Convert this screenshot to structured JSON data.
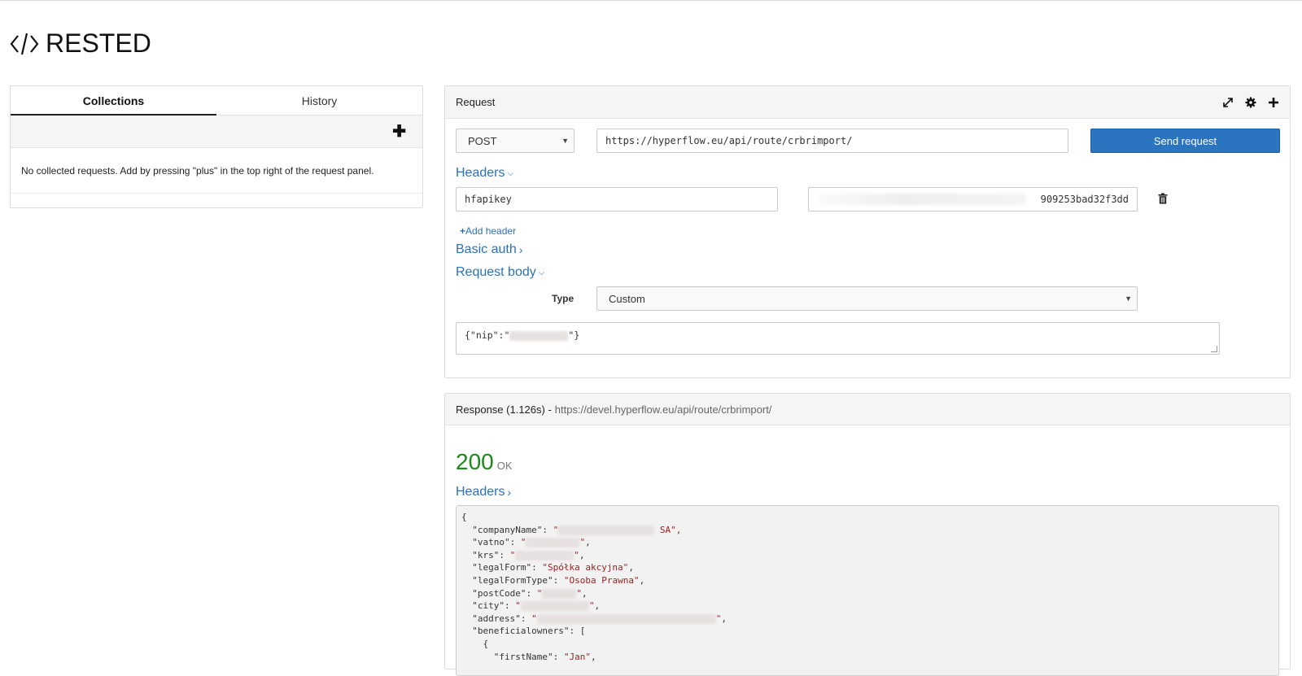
{
  "brand": {
    "title": "RESTED"
  },
  "left": {
    "tabs": [
      {
        "label": "Collections",
        "active": true
      },
      {
        "label": "History",
        "active": false
      }
    ],
    "empty_message": "No collected requests. Add by pressing \"plus\" in the top right of the request panel."
  },
  "request": {
    "title": "Request",
    "method": "POST",
    "url": "https://hyperflow.eu/api/route/crbrimport/",
    "send_label": "Send request",
    "headers_label": "Headers",
    "header_row": {
      "key": "hfapikey",
      "value_visible": "909253bad32f3dd"
    },
    "add_header_label": "Add header",
    "basic_auth_label": "Basic auth",
    "body_label": "Request body",
    "type_label": "Type",
    "type_value": "Custom",
    "body_prefix": "{\"nip\":\"",
    "body_suffix": "\"}"
  },
  "response": {
    "title": "Response (1.126s) -",
    "url": "https://devel.hyperflow.eu/api/route/crbrimport/",
    "status_code": "200",
    "status_text": "OK",
    "headers_label": "Headers",
    "json_lines": {
      "open": "{",
      "company_key": "\"companyName\": ",
      "company_suffix": " SA\",",
      "vatno_key": "\"vatno\": ",
      "krs_key": "\"krs\": ",
      "legal_form_key": "\"legalForm\": ",
      "legal_form_val": "\"Spółka akcyjna\"",
      "legal_type_key": "\"legalFormType\": ",
      "legal_type_val": "\"Osoba Prawna\"",
      "postcode_key": "\"postCode\": ",
      "city_key": "\"city\": ",
      "address_key": "\"address\": ",
      "owners_key": "\"beneficialowners\": [",
      "obj_open": "{",
      "firstname_key": "\"firstName\": ",
      "firstname_val": "\"Jan\""
    }
  }
}
